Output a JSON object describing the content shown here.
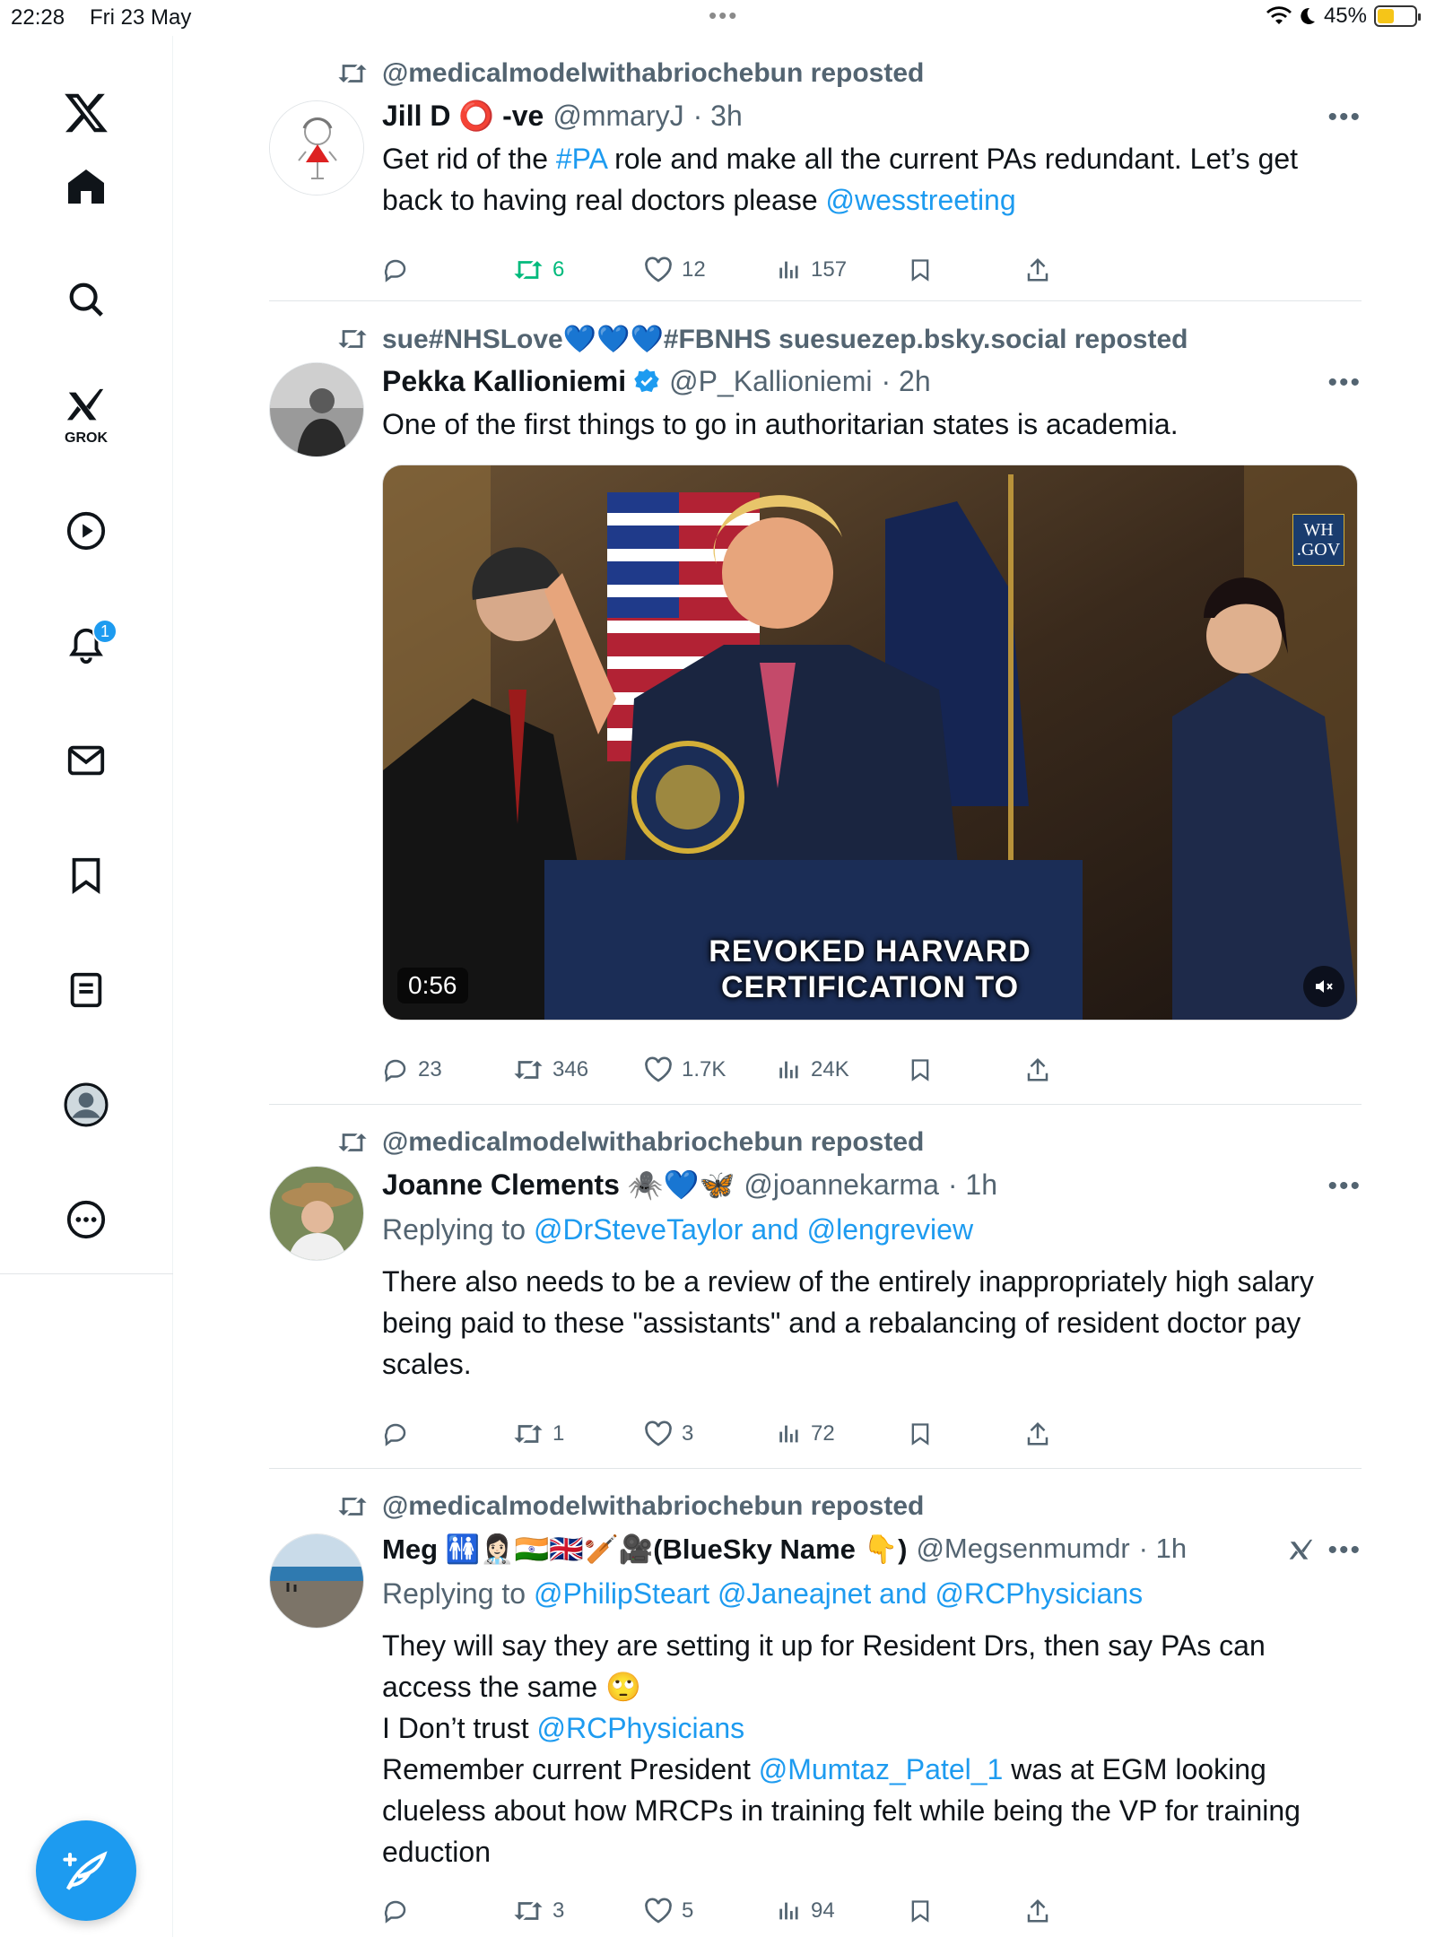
{
  "status_bar": {
    "time": "22:28",
    "date": "Fri 23 May",
    "battery": "45%",
    "battery_level": 0.45
  },
  "sidebar": {
    "grok_label": "GROK",
    "notifications_badge": "1",
    "items": [
      "x-logo",
      "home",
      "search",
      "grok",
      "videos",
      "notifications",
      "messages",
      "bookmarks",
      "lists",
      "profile",
      "more"
    ]
  },
  "posts": [
    {
      "repost_by": "@medicalmodelwithabriochebun reposted",
      "name": "Jill D ⭕ -ve",
      "handle": "@mmaryJ",
      "time": "· 3h",
      "text_parts": [
        "Get rid of the ",
        "#PA",
        " role and make all the current PAs redundant. Let’s get back to having real doctors please ",
        "@wesstreeting"
      ],
      "replies": "",
      "reposts": "6",
      "likes": "12",
      "views": "157"
    },
    {
      "repost_by": "sue#NHSLove💙💙💙#FBNHS suesuezep.bsky.social reposted",
      "name": "Pekka Kallioniemi",
      "handle": "@P_Kallioniemi",
      "time": "· 2h",
      "text": "One of the first things to go in authoritarian states is academia.",
      "media": {
        "duration": "0:56",
        "caption_line1": "REVOKED HARVARD",
        "caption_line2": "CERTIFICATION TO",
        "watermark_line1": "WH",
        "watermark_line2": ".GOV"
      },
      "replies": "23",
      "reposts": "346",
      "likes": "1.7K",
      "views": "24K"
    },
    {
      "repost_by": "@medicalmodelwithabriochebun reposted",
      "name": "Joanne Clements 🕷️💙🦋",
      "handle": "@joannekarma",
      "time": "· 1h",
      "replying_label": "Replying to ",
      "replying_to": "@DrSteveTaylor and @lengreview",
      "text": "There also needs to be a review of the entirely inappropriately high salary being paid to these \"assistants\" and a rebalancing of resident doctor pay scales.",
      "replies": "",
      "reposts": "1",
      "likes": "3",
      "views": "72"
    },
    {
      "repost_by": "@medicalmodelwithabriochebun reposted",
      "name": "Meg 🚻👩🏻‍⚕️🇮🇳🇬🇧🏏🎥(BlueSky Name 👇)",
      "handle": "@Megsenmumdr",
      "time": "· 1h",
      "replying_label": "Replying to ",
      "replying_to": "@PhilipSteart @Janeajnet and @RCPhysicians",
      "line1": "They will say they are setting it up for Resident Drs, then say PAs can access the same 🙄",
      "line2_prefix": "I Don’t trust ",
      "line2_mention": "@RCPhysicians",
      "line3_prefix": "Remember current President ",
      "line3_mention": "@Mumtaz_Patel_1",
      "line3_suffix": " was at EGM looking clueless about how MRCPs in training  felt while being the VP for training eduction",
      "replies": "",
      "reposts": "3",
      "likes": "5",
      "views": "94"
    }
  ]
}
